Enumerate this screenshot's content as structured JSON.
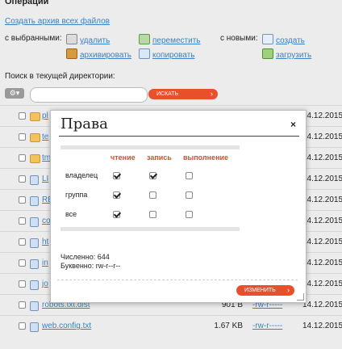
{
  "header": {
    "title": "Операции"
  },
  "archive_all_link": "Создать архив всех файлов",
  "selected": {
    "label": "с выбранными:",
    "delete": "удалить",
    "move": "переместить",
    "archive": "архивировать",
    "copy": "копировать"
  },
  "new_items": {
    "label": "с новыми:",
    "create": "создать",
    "upload": "загрузить"
  },
  "search": {
    "label": "Поиск в текущей директории:",
    "placeholder": "",
    "button": "искать"
  },
  "files": [
    {
      "name": "pl",
      "type": "folder",
      "size": "",
      "perms": "",
      "date": "14.12.2015"
    },
    {
      "name": "te",
      "type": "folder",
      "size": "",
      "perms": "",
      "date": "14.12.2015"
    },
    {
      "name": "tm",
      "type": "folder",
      "size": "",
      "perms": "",
      "date": "14.12.2015"
    },
    {
      "name": "LI",
      "type": "file",
      "size": "",
      "perms": "",
      "date": "14.12.2015"
    },
    {
      "name": "RE",
      "type": "file",
      "size": "",
      "perms": "",
      "date": "14.12.2015"
    },
    {
      "name": "co",
      "type": "file",
      "size": "",
      "perms": "",
      "date": "14.12.2015"
    },
    {
      "name": "ht",
      "type": "file",
      "size": "",
      "perms": "",
      "date": "14.12.2015"
    },
    {
      "name": "in",
      "type": "file",
      "size": "",
      "perms": "",
      "date": "14.12.2015"
    },
    {
      "name": "jo",
      "type": "file",
      "size": "",
      "perms": "",
      "date": "14.12.2015"
    },
    {
      "name": "robots.txt.dist",
      "type": "file",
      "size": "901 B",
      "perms": "-rw-r-----",
      "date": "14.12.2015"
    },
    {
      "name": "web.config.txt",
      "type": "file",
      "size": "1.67 KB",
      "perms": "-rw-r-----",
      "date": "14.12.2015"
    }
  ],
  "modal": {
    "title": "Права",
    "close": "×",
    "columns": [
      "чтение",
      "запись",
      "выполнение"
    ],
    "rows": [
      {
        "label": "владелец",
        "read": true,
        "write": true,
        "execute": false
      },
      {
        "label": "группа",
        "read": true,
        "write": false,
        "execute": false
      },
      {
        "label": "все",
        "read": true,
        "write": false,
        "execute": false
      }
    ],
    "numeric_label": "Численно: 644",
    "symbolic_label": "Буквенно: rw-r--r--",
    "change_button": "изменить"
  }
}
